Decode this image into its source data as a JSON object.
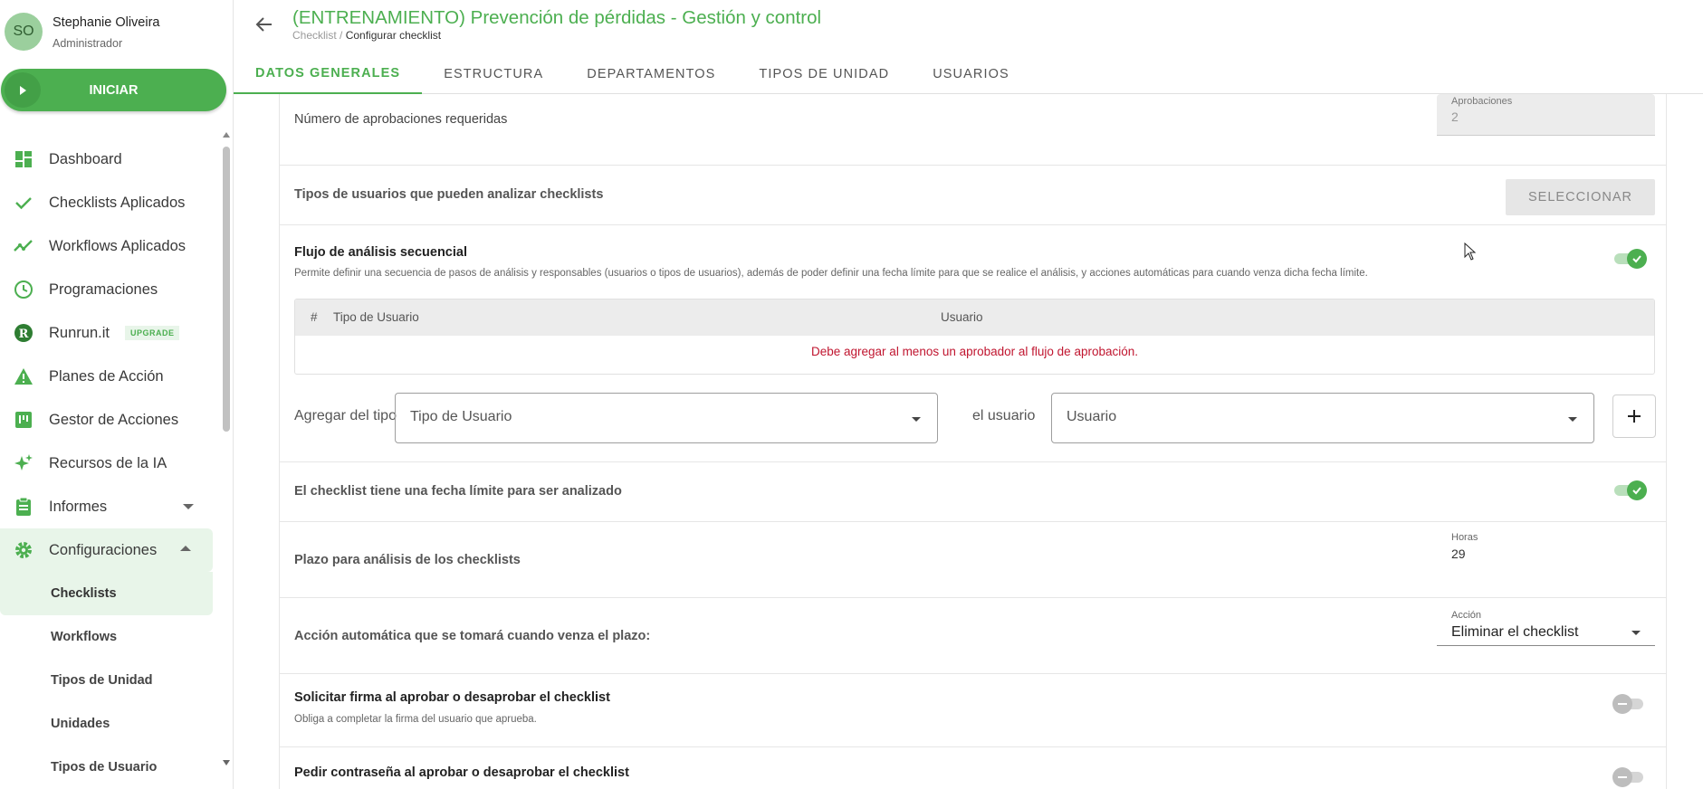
{
  "user": {
    "initials": "SO",
    "name": "Stephanie Oliveira",
    "role": "Administrador"
  },
  "start_button": {
    "label": "INICIAR"
  },
  "sidebar": {
    "items": [
      {
        "label": "Dashboard",
        "icon": "dashboard-icon"
      },
      {
        "label": "Checklists Aplicados",
        "icon": "check-icon"
      },
      {
        "label": "Workflows Aplicados",
        "icon": "trend-icon"
      },
      {
        "label": "Programaciones",
        "icon": "clock-icon"
      },
      {
        "label": "Runrun.it",
        "icon": "runrun-icon",
        "badge": "UPGRADE"
      },
      {
        "label": "Planes de Acción",
        "icon": "warning-icon"
      },
      {
        "label": "Gestor de Acciones",
        "icon": "kanban-icon"
      },
      {
        "label": "Recursos de la IA",
        "icon": "sparkle-icon"
      },
      {
        "label": "Informes",
        "icon": "clipboard-icon"
      },
      {
        "label": "Configuraciones",
        "icon": "gear-icon"
      }
    ],
    "sub_items": [
      {
        "label": "Checklists"
      },
      {
        "label": "Workflows"
      },
      {
        "label": "Tipos de Unidad"
      },
      {
        "label": "Unidades"
      },
      {
        "label": "Tipos de Usuario"
      }
    ]
  },
  "header": {
    "title": "(ENTRENAMIENTO) Prevención de pérdidas - Gestión y control",
    "breadcrumb_parent": "Checklist",
    "breadcrumb_sep": " / ",
    "breadcrumb_current": "Configurar checklist",
    "tabs": [
      {
        "label": "DATOS GENERALES"
      },
      {
        "label": "ESTRUCTURA"
      },
      {
        "label": "DEPARTAMENTOS"
      },
      {
        "label": "TIPOS DE UNIDAD"
      },
      {
        "label": "USUARIOS"
      }
    ]
  },
  "settings": {
    "approvals": {
      "label": "Número de aprobaciones requeridas",
      "field_caption": "Aprobaciones",
      "field_value": "2"
    },
    "user_types": {
      "label": "Tipos de usuarios que pueden analizar checklists",
      "button": "SELECCIONAR"
    },
    "sequential": {
      "label": "Flujo de análisis secuencial",
      "desc": "Permite definir una secuencia de pasos de análisis y responsables (usuarios o tipos de usuarios), además de poder definir una fecha límite para que se realice el análisis, y acciones automáticas para cuando venza dicha fecha límite.",
      "enabled": true,
      "table_headers": [
        "#",
        "Tipo de Usuario",
        "Usuario"
      ],
      "empty_message": "Debe agregar al menos un aprobador al flujo de aprobación.",
      "add_label": "Agregar del tipo",
      "type_placeholder": "Tipo de Usuario",
      "user_label": "el usuario",
      "user_placeholder": "Usuario"
    },
    "deadline": {
      "label": "El checklist tiene una fecha límite para ser analizado",
      "enabled": true
    },
    "term": {
      "label": "Plazo para análisis de los checklists",
      "field_caption": "Horas",
      "field_value": "29"
    },
    "auto_action": {
      "label": "Acción automática que se tomará cuando venza el plazo:",
      "field_caption": "Acción",
      "field_value": "Eliminar el checklist"
    },
    "signature": {
      "label": "Solicitar firma al aprobar o desaprobar el checklist",
      "desc": "Obliga a completar la firma del usuario que aprueba.",
      "enabled": false
    },
    "password": {
      "label": "Pedir contraseña al aprobar o desaprobar el checklist",
      "enabled": false
    }
  },
  "colors": {
    "accent": "#4caf50",
    "error": "#c0152f"
  }
}
